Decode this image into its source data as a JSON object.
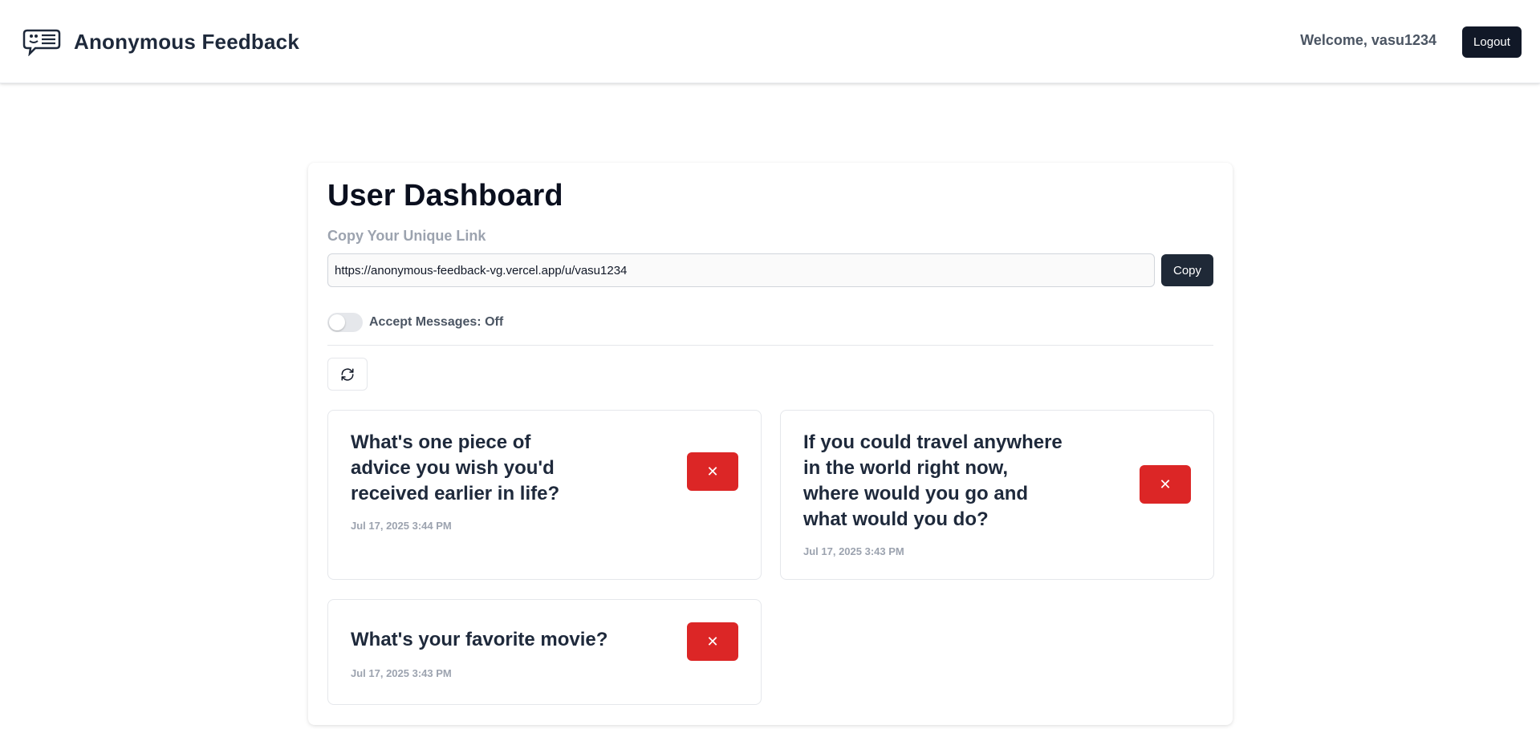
{
  "navbar": {
    "brand_title": "Anonymous Feedback",
    "brand_icon": "feedback-chat-icon",
    "welcome_text": "Welcome, vasu1234",
    "logout_label": "Logout"
  },
  "dashboard": {
    "title": "User Dashboard",
    "link_label": "Copy Your Unique Link",
    "unique_link": "https://anonymous-feedback-vg.vercel.app/u/vasu1234",
    "copy_label": "Copy",
    "accept_messages_label": "Accept Messages: Off",
    "refresh_icon": "refresh-icon"
  },
  "messages": [
    {
      "text": "What's one piece of advice you wish you'd received earlier in life?",
      "date": "Jul 17, 2025 3:44 PM",
      "delete_label": "✕"
    },
    {
      "text": "If you could travel anywhere in the world right now, where would you go and what would you do?",
      "date": "Jul 17, 2025 3:43 PM",
      "delete_label": "✕"
    },
    {
      "text": "What's your favorite movie?",
      "date": "Jul 17, 2025 3:43 PM",
      "delete_label": "✕"
    }
  ],
  "colors": {
    "primary_dark": "#111827",
    "delete_red": "#dc2626",
    "muted_text": "#9ca3af"
  }
}
